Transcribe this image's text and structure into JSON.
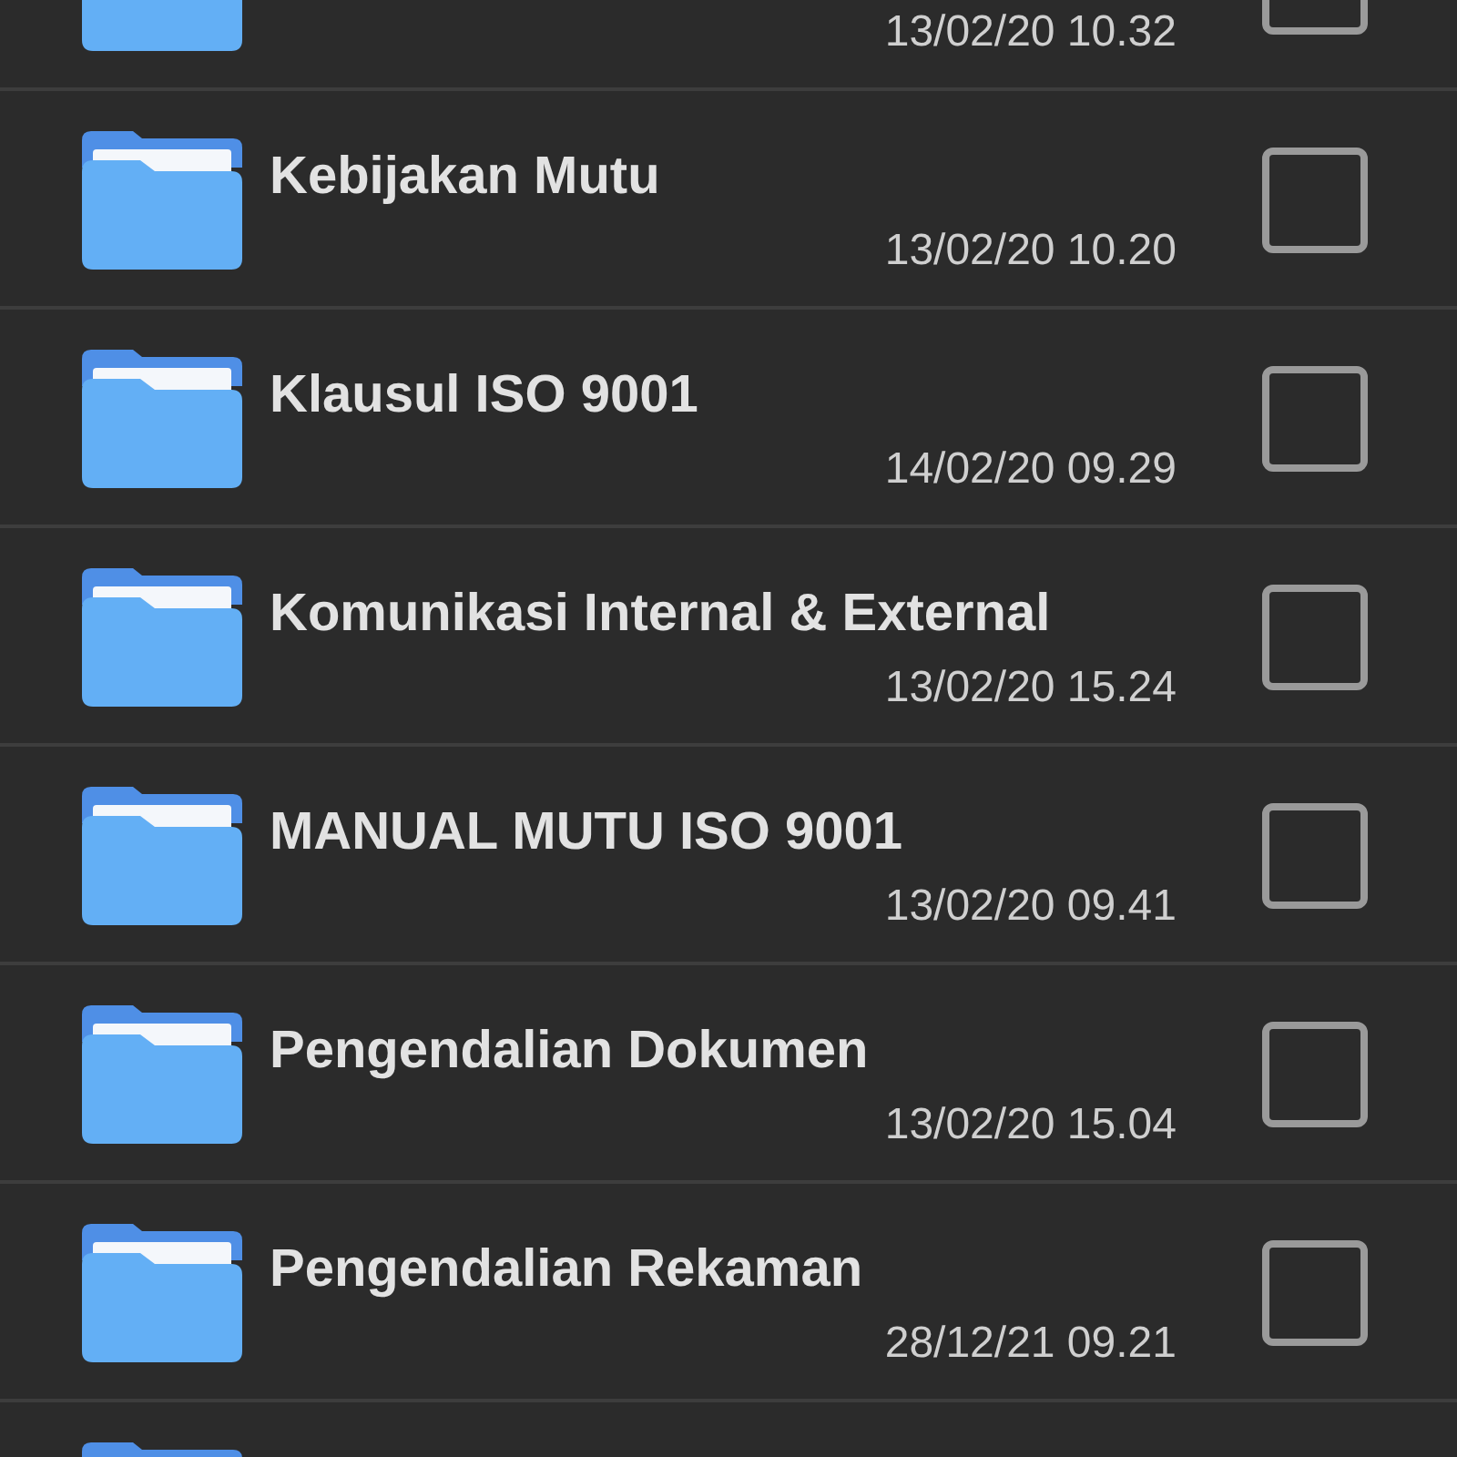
{
  "files": [
    {
      "kind": "folder",
      "date": "13/02/20 10.32",
      "checked": false
    },
    {
      "kind": "folder",
      "title": "Kebijakan Mutu",
      "date": "13/02/20 10.20",
      "checked": false
    },
    {
      "kind": "folder",
      "title": "Klausul ISO 9001",
      "date": "14/02/20 09.29",
      "checked": false
    },
    {
      "kind": "folder",
      "title": "Komunikasi Internal & External",
      "date": "13/02/20 15.24",
      "checked": false
    },
    {
      "kind": "folder",
      "title": "MANUAL MUTU ISO 9001",
      "date": "13/02/20 09.41",
      "checked": false
    },
    {
      "kind": "folder",
      "title": "Pengendalian Dokumen",
      "date": "13/02/20 15.04",
      "checked": false
    },
    {
      "kind": "folder",
      "title": "Pengendalian Rekaman",
      "date": "28/12/21 09.21",
      "checked": false
    },
    {
      "kind": "folder"
    }
  ]
}
